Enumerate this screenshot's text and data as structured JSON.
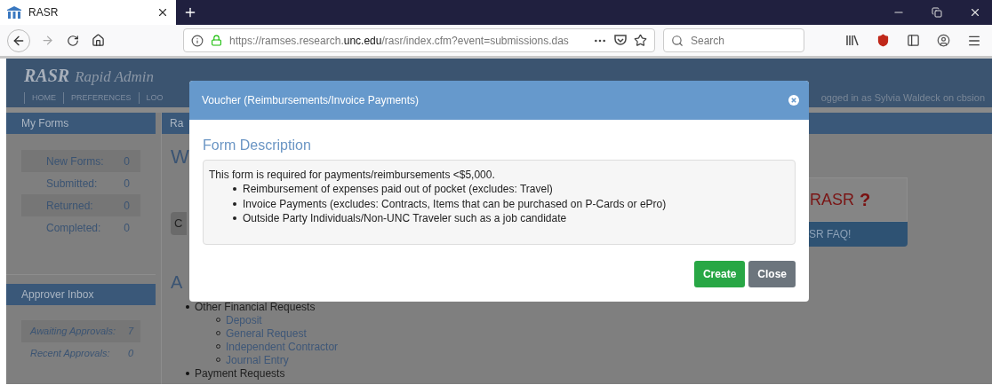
{
  "browser": {
    "tab": {
      "title": "RASR"
    },
    "url": "https://ramses.research.**unc.edu**/rasr/index.cfm?event=submissions.das",
    "search": {
      "placeholder": "Search"
    }
  },
  "page": {
    "header": {
      "title": "RASR",
      "subtitle": "Rapid Admin",
      "nav": [
        "HOME",
        "PREFERENCES",
        "LOO"
      ],
      "user": "ogged in as Sylvia Waldeck on cbsion"
    },
    "sidebar": [
      {
        "title": "My Forms",
        "items": [
          {
            "label": "New Forms:",
            "count": "0"
          },
          {
            "label": "Submitted:",
            "count": "0"
          },
          {
            "label": "Returned:",
            "count": "0"
          },
          {
            "label": "Completed:",
            "count": "0"
          }
        ]
      },
      {
        "title": "Approver Inbox",
        "items": [
          {
            "label": "Awaiting Approvals:",
            "count": "7"
          },
          {
            "label": "Recent Approvals:",
            "count": "0"
          }
        ]
      }
    ],
    "main": {
      "tab": "Ra",
      "heading": "W",
      "button": "C",
      "section_heading": "A",
      "groups": [
        {
          "label": "Other Financial Requests",
          "children": [
            {
              "label": "Deposit"
            },
            {
              "label": "General Request"
            },
            {
              "label": "Independent Contractor"
            },
            {
              "label": "Journal Entry"
            }
          ]
        },
        {
          "label": "Payment Requests"
        }
      ],
      "help_box": {
        "title": "RASR",
        "mark": "?",
        "button": "SR FAQ!"
      }
    }
  },
  "modal": {
    "title": "Voucher (Reimbursements/Invoice Payments)",
    "section": "Form Description",
    "intro": "This form is required for payments/reimbursements <$5,000.",
    "bullets": [
      "Reimbursement of expenses paid out of pocket (excludes: Travel)",
      "Invoice Payments (excludes: Contracts, Items that can be purchased on P-Cards or ePro)",
      "Outside Party Individuals/Non-UNC Traveler such as a job candidate"
    ],
    "buttons": [
      {
        "label": "Create",
        "kind": "primary"
      },
      {
        "label": "Close",
        "kind": "secondary"
      }
    ]
  }
}
